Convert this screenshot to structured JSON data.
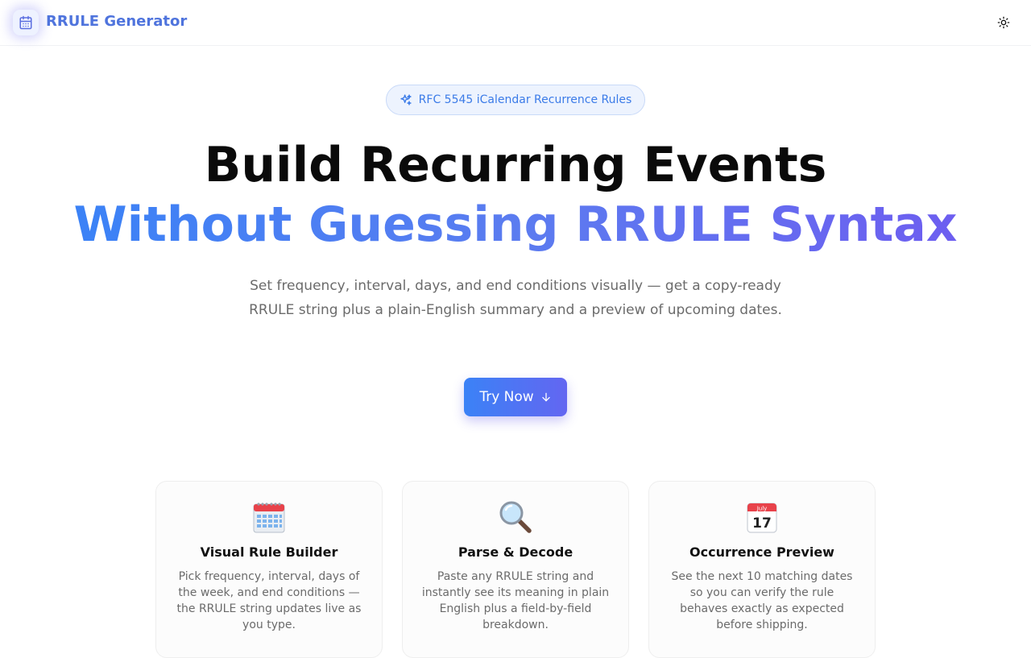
{
  "header": {
    "brand": "RRULE Generator",
    "logo_icon": "calendar-icon",
    "theme_icon": "sun-icon"
  },
  "hero": {
    "badge_icon": "sparkles-icon",
    "badge_text": "RFC 5545 iCalendar Recurrence Rules",
    "title_line1": "Build Recurring Events",
    "title_line2": "Without Guessing RRULE Syntax",
    "subtitle": "Set frequency, interval, days, and end conditions visually — get a copy-ready RRULE string plus a plain-English summary and a preview of upcoming dates.",
    "cta_label": "Try Now",
    "cta_icon": "arrow-down-icon"
  },
  "features": [
    {
      "icon": "spiral-calendar-icon",
      "title": "Visual Rule Builder",
      "description": "Pick frequency, interval, days of the week, and end conditions — the RRULE string updates live as you type."
    },
    {
      "icon": "magnifying-glass-icon",
      "title": "Parse & Decode",
      "description": "Paste any RRULE string and instantly see its meaning in plain English plus a field-by-field breakdown."
    },
    {
      "icon": "calendar-date-icon",
      "calendar_month": "July",
      "calendar_day": "17",
      "title": "Occurrence Preview",
      "description": "See the next 10 matching dates so you can verify the rule behaves exactly as expected before shipping."
    }
  ],
  "colors": {
    "brand": "#4f74dd",
    "accent_start": "#3b82f6",
    "accent_end": "#6366f1",
    "badge_bg": "#edf3fe"
  }
}
